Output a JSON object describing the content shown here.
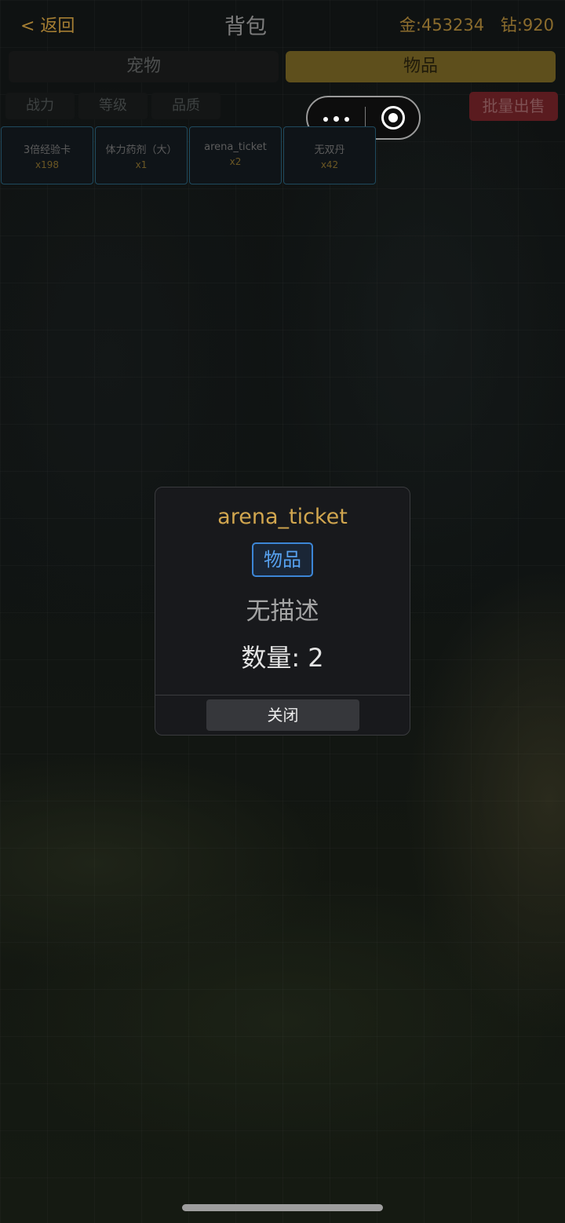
{
  "header": {
    "back_label": "< 返回",
    "title": "背包",
    "gold": "金:453234",
    "diamond": "钻:920"
  },
  "tabs": [
    {
      "label": "宠物",
      "active": false
    },
    {
      "label": "物品",
      "active": true
    }
  ],
  "sort_buttons": [
    "战力",
    "等级",
    "品质"
  ],
  "sell_button": "批量出售",
  "inventory": [
    {
      "name": "3倍经验卡",
      "qty": "x198"
    },
    {
      "name": "体力药剂（大）",
      "qty": "x1"
    },
    {
      "name": "arena_ticket",
      "qty": "x2"
    },
    {
      "name": "无双丹",
      "qty": "x42"
    }
  ],
  "modal": {
    "name": "arena_ticket",
    "type": "物品",
    "description": "无描述",
    "quantity_label": "数量:",
    "quantity": "2",
    "close_label": "关闭"
  },
  "colors": {
    "accent_gold": "#d1a64f",
    "tag_blue": "#57a1ef",
    "sell_red": "#5a1b1f"
  }
}
